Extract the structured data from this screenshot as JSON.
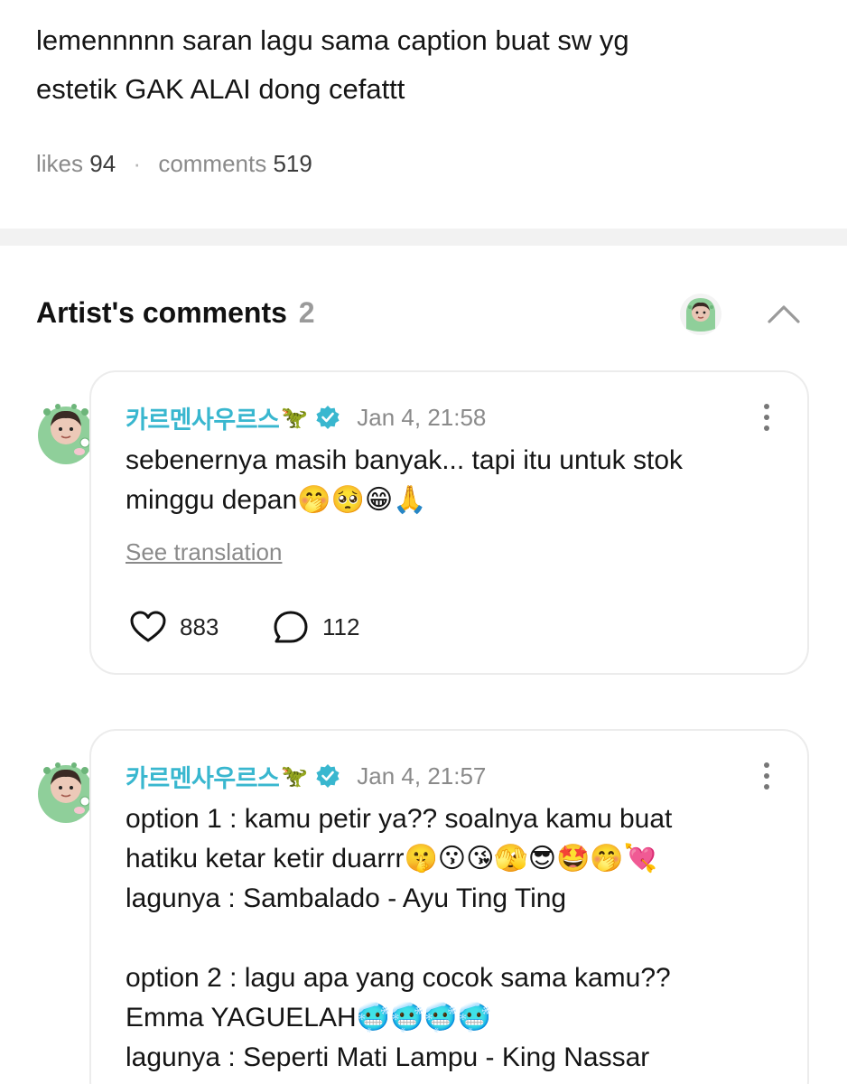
{
  "post": {
    "body_lines": [
      "lemennnnn saran lagu sama caption buat sw yg",
      "estetik GAK ALAI dong cefattt"
    ],
    "likes_label": "likes",
    "likes_count": "94",
    "separator": "·",
    "comments_label": "comments",
    "comments_count": "519"
  },
  "artist_comments": {
    "title": "Artist's comments",
    "count": "2",
    "collapse_icon": "chevron-up-icon"
  },
  "comments": [
    {
      "author": "카르멘사우르스",
      "author_emoji": "🦖",
      "verified_icon": "verified-badge-icon",
      "timestamp": "Jan 4, 21:58",
      "text": "sebenernya masih banyak... tapi itu untuk stok\nminggu depan🤭🥺😁🙏",
      "see_translation": "See translation",
      "likes": "883",
      "replies": "112"
    },
    {
      "author": "카르멘사우르스",
      "author_emoji": "🦖",
      "verified_icon": "verified-badge-icon",
      "timestamp": "Jan 4, 21:57",
      "text": "option 1 : kamu petir ya?? soalnya kamu buat\nhatiku ketar ketir duarrr🤫😗😘🫣😎🤩🤭💘\nlagunya : Sambalado - Ayu Ting Ting\n\noption 2 : lagu apa yang cocok sama kamu??\nEmma YAGUELAH🥶🥶🥶🥶\nlagunya : Seperti Mati Lampu - King Nassar"
    }
  ],
  "colors": {
    "accent": "#39b7cf",
    "muted": "#8a8a8a",
    "divider": "#f2f2f2",
    "card_border": "#ececec"
  }
}
